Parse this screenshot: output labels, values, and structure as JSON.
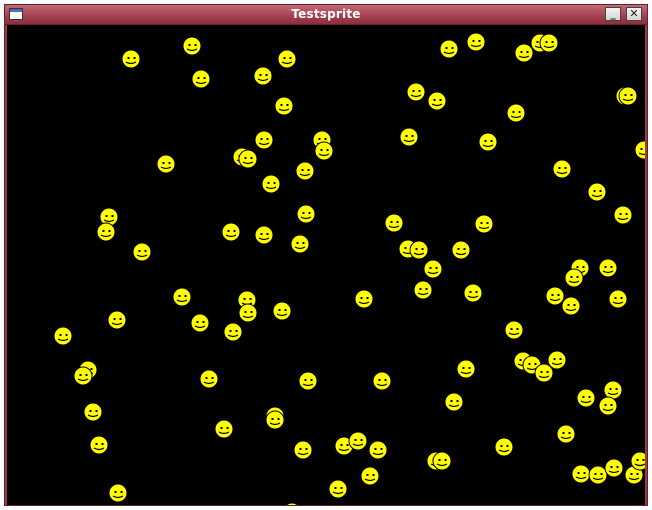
{
  "window": {
    "title": "Testsprite",
    "minimize_label": "_",
    "close_label": "✕"
  },
  "colors": {
    "background": "#000000",
    "sprite_fill": "#ffff00",
    "sprite_outline": "#000000",
    "titlebar": "#a23f4d"
  },
  "icons": {
    "window_icon": "window-app-icon",
    "minimize": "minimize-icon",
    "close": "close-icon",
    "sprite": "smiley-face-icon"
  }
}
